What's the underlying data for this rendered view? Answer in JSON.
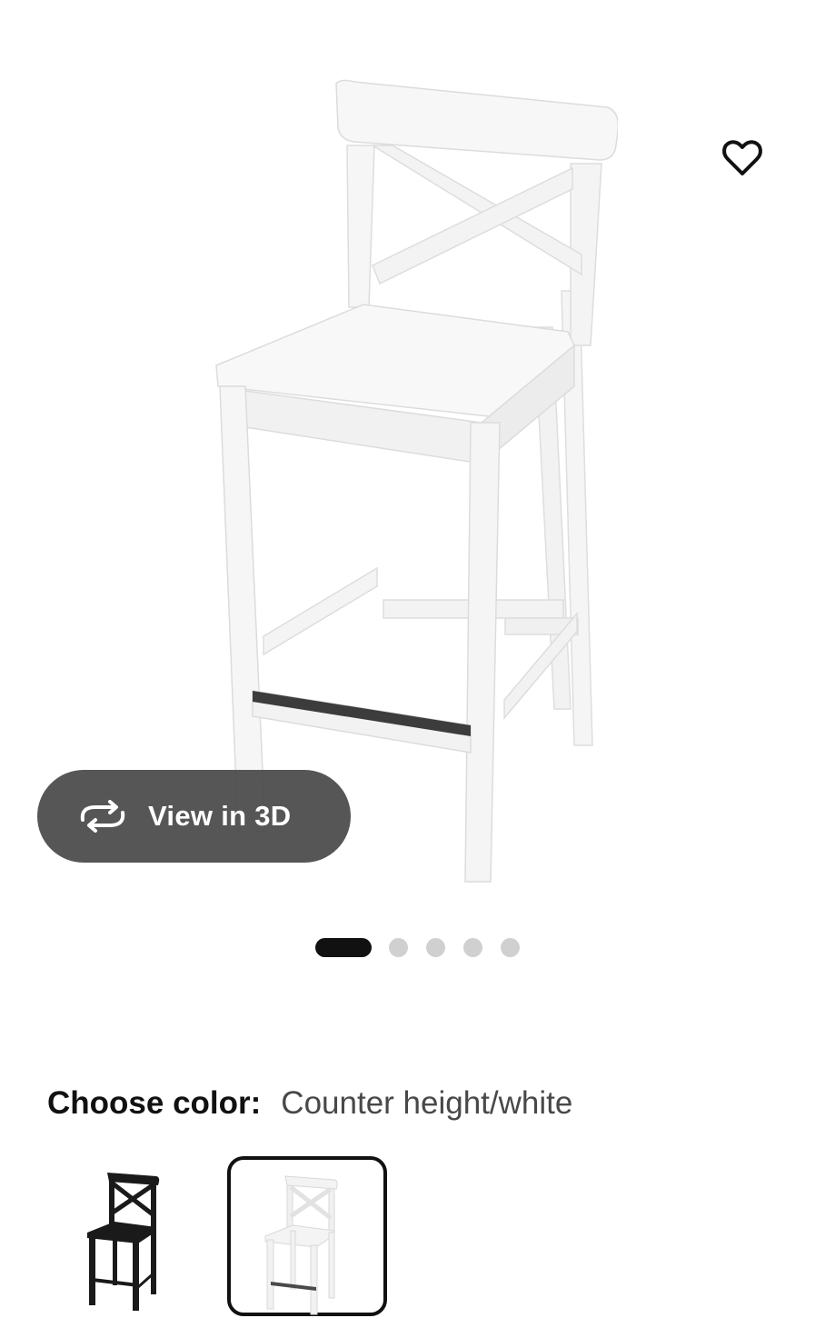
{
  "gallery": {
    "image_name": "white bar stool with backrest",
    "view3d_label": "View in 3D",
    "slide_count": 5,
    "active_slide": 1
  },
  "color_chooser": {
    "label": "Choose color:",
    "selected_value": "Counter height/white",
    "options": [
      {
        "name": "black-brown",
        "color": "#1a1a1a",
        "selected": false
      },
      {
        "name": "white",
        "color": "#f4f4f4",
        "selected": true
      }
    ]
  },
  "colors": {
    "accent_dark": "#111111",
    "pill_bg": "#484848",
    "dot_inactive": "#d0d0d0"
  }
}
